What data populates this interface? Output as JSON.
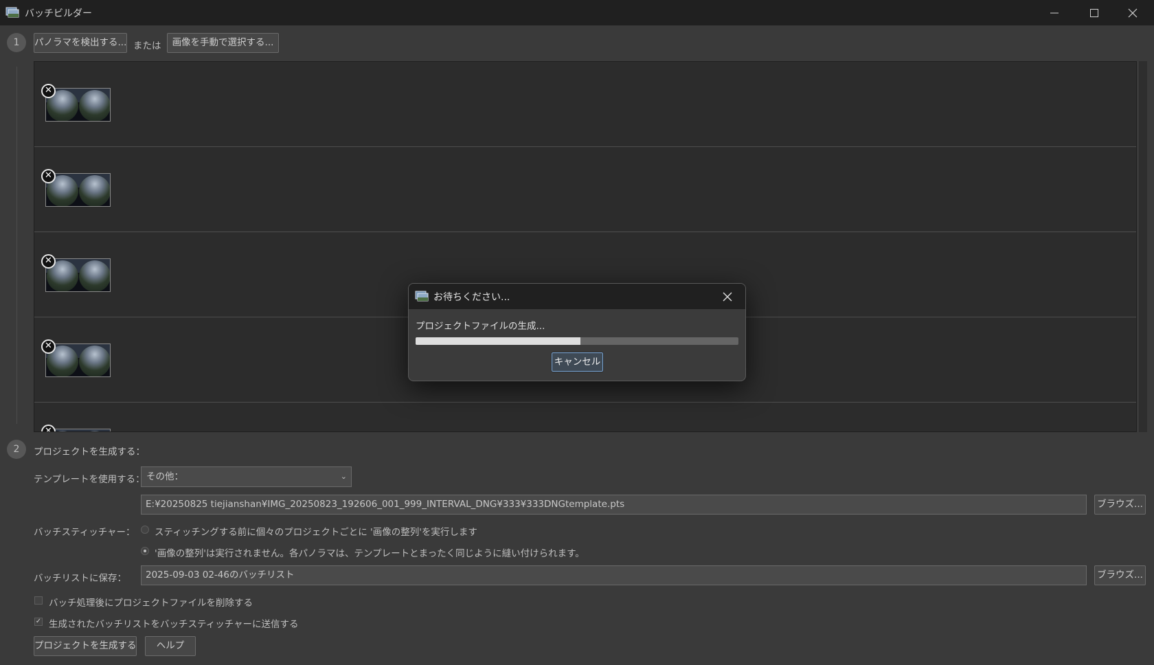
{
  "window": {
    "title": "バッチビルダー"
  },
  "step1": {
    "number": "1",
    "detect_button": "パノラマを検出する...",
    "or_text": "または",
    "manual_button": "画像を手動で選択する..."
  },
  "rows": [
    {
      "remove": "✕"
    },
    {
      "remove": "✕"
    },
    {
      "remove": "✕"
    },
    {
      "remove": "✕"
    },
    {
      "remove": "✕"
    }
  ],
  "step2": {
    "number": "2",
    "heading": "プロジェクトを生成する：",
    "template_label": "テンプレートを使用する：",
    "template_value": "その他：",
    "template_path": "E:¥20250825 tiejianshan¥IMG_20250823_192606_001_999_INTERVAL_DNG¥333¥333DNGtemplate.pts",
    "browse_label": "ブラウズ...",
    "stitcher_label": "バッチスティッチャー：",
    "option_align": "スティッチングする前に個々のプロジェクトごとに '画像の整列'を実行します",
    "option_no_align": "'画像の整列'は実行されません。各パノラマは、テンプレートとまったく同じように縫い付けられます。",
    "save_label": "バッチリストに保存：",
    "save_value": "2025-09-03 02-46のバッチリスト",
    "delete_after": "バッチ処理後にプロジェクトファイルを削除する",
    "send_to_stitcher": "生成されたバッチリストをバッチスティッチャーに送信する",
    "generate_button": "プロジェクトを生成する",
    "help_button": "ヘルプ"
  },
  "dialog": {
    "title": "お待ちください...",
    "message": "プロジェクトファイルの生成...",
    "progress": 0.51,
    "cancel": "キャンセル"
  },
  "colors": {
    "titlebar": "#202020",
    "panel": "#3a3a3a",
    "list": "#2c2c2c",
    "focus": "#7aa6d6"
  }
}
